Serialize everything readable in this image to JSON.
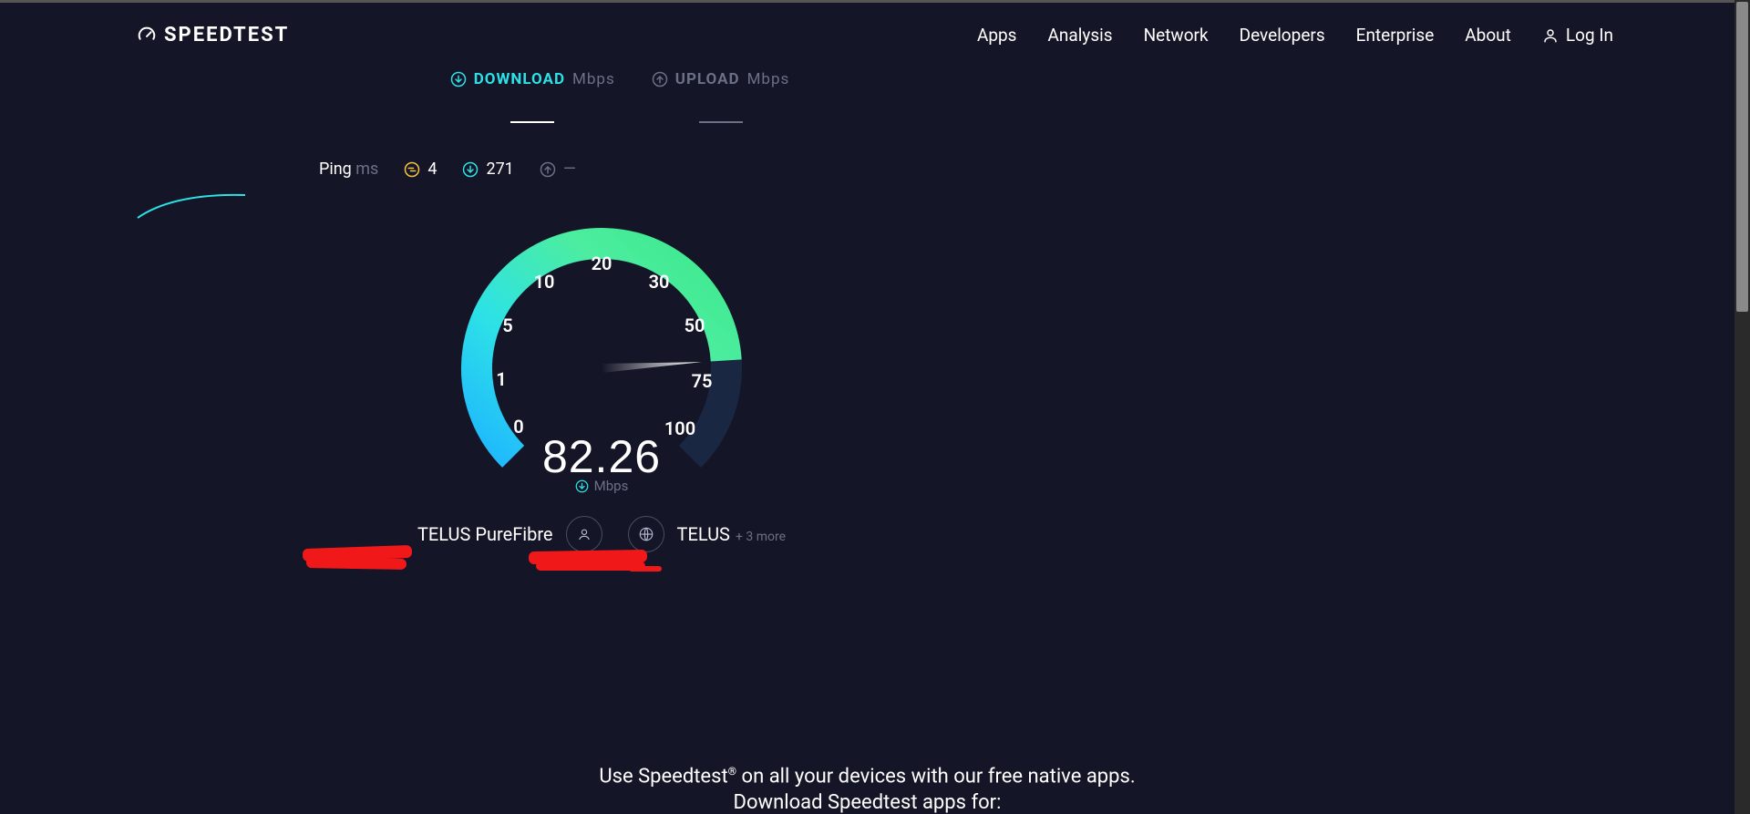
{
  "brand": "SPEEDTEST",
  "nav": {
    "items": [
      "Apps",
      "Analysis",
      "Network",
      "Developers",
      "Enterprise",
      "About"
    ],
    "login": "Log In"
  },
  "tabs": {
    "download": {
      "label": "DOWNLOAD",
      "unit": "Mbps"
    },
    "upload": {
      "label": "UPLOAD",
      "unit": "Mbps"
    }
  },
  "ping": {
    "label": "Ping",
    "unit": "ms",
    "idle": "4",
    "down": "271",
    "up": "—"
  },
  "gauge": {
    "ticks": [
      "0",
      "1",
      "5",
      "10",
      "20",
      "30",
      "50",
      "75",
      "100"
    ],
    "speed": "82.26",
    "unit": "Mbps",
    "max_angle_deg": 270,
    "fill_fraction": 0.82
  },
  "server": {
    "isp": "TELUS PureFibre",
    "host": "TELUS",
    "extra": "+ 3 more"
  },
  "footer": {
    "line1_pre": "Use Speedtest",
    "line1_post": " on all your devices with our free native apps.",
    "line2": "Download Speedtest apps for:"
  },
  "colors": {
    "accent_teal": "#2de2e6",
    "accent_green": "#3ce88a",
    "accent_yellow": "#f5c542",
    "muted": "#6c7086",
    "redact": "#f01818"
  }
}
